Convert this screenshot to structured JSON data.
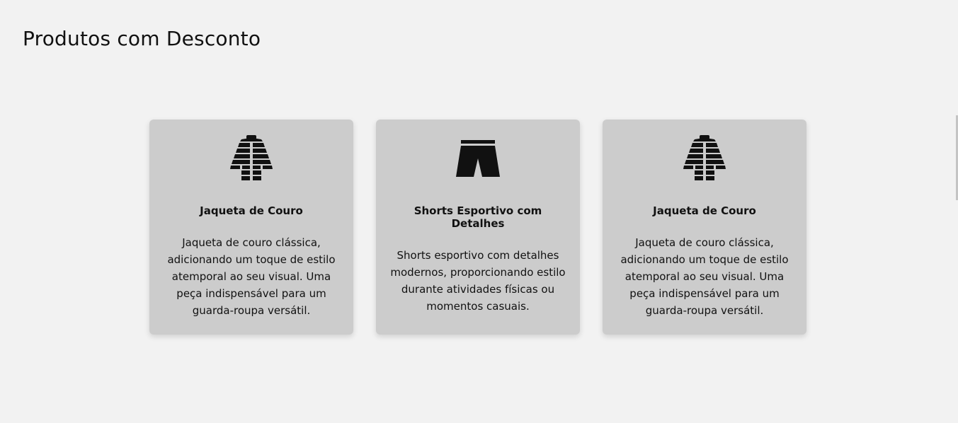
{
  "page": {
    "title": "Produtos com Desconto"
  },
  "products": [
    {
      "icon": "jacket-icon",
      "name": "Jaqueta de Couro",
      "description": "Jaqueta de couro clássica, adicionando um toque de estilo atemporal ao seu visual. Uma peça indispensável para um guarda-roupa versátil."
    },
    {
      "icon": "shorts-icon",
      "name": "Shorts Esportivo com Detalhes",
      "description": "Shorts esportivo com detalhes modernos, proporcionando estilo durante atividades físicas ou momentos casuais."
    },
    {
      "icon": "jacket-icon",
      "name": "Jaqueta de Couro",
      "description": "Jaqueta de couro clássica, adicionando um toque de estilo atemporal ao seu visual. Uma peça indispensável para um guarda-roupa versátil."
    }
  ],
  "colors": {
    "background": "#f2f2f2",
    "card": "#cccccc",
    "icon": "#111111"
  }
}
